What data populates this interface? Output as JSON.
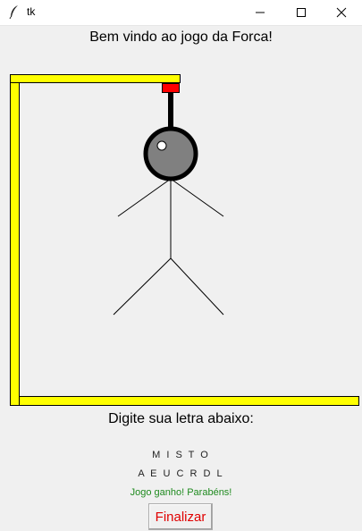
{
  "window": {
    "title": "tk",
    "app_icon": "feather-icon",
    "controls": [
      "minimize-icon",
      "maximize-icon",
      "close-icon"
    ]
  },
  "game": {
    "welcome": "Bem vindo ao jogo da Forca!",
    "prompt": "Digite sua letra abaixo:",
    "word": "M I S T O",
    "guessed_letters": "A E U C R D L",
    "status": "Jogo ganho! Parabéns!",
    "status_color": "#1f8a1f"
  },
  "buttons": {
    "finish_label": "Finalizar",
    "finish_color": "#e00000"
  },
  "colors": {
    "gallows": "#ffff00",
    "hook": "#ff0000",
    "head_fill": "#808080",
    "rope": "#000000",
    "background": "#f0f0f0"
  }
}
